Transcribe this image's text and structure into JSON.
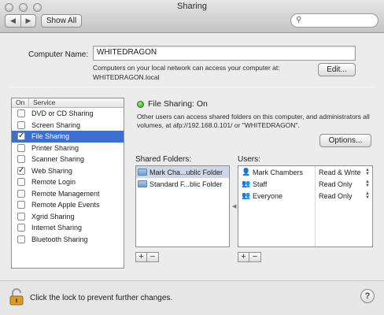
{
  "window": {
    "title": "Sharing"
  },
  "toolbar": {
    "back": "◀",
    "forward": "▶",
    "show_all": "Show All",
    "search_placeholder": ""
  },
  "computer_name": {
    "label": "Computer Name:",
    "value": "WHITEDRAGON",
    "note_line1": "Computers on your local network can access your computer at:",
    "note_line2": "WHITEDRAGON.local",
    "edit_button": "Edit..."
  },
  "services": {
    "header_on": "On",
    "header_service": "Service",
    "items": [
      {
        "label": "DVD or CD Sharing",
        "on": false,
        "selected": false
      },
      {
        "label": "Screen Sharing",
        "on": false,
        "selected": false
      },
      {
        "label": "File Sharing",
        "on": true,
        "selected": true
      },
      {
        "label": "Printer Sharing",
        "on": false,
        "selected": false
      },
      {
        "label": "Scanner Sharing",
        "on": false,
        "selected": false
      },
      {
        "label": "Web Sharing",
        "on": true,
        "selected": false
      },
      {
        "label": "Remote Login",
        "on": false,
        "selected": false
      },
      {
        "label": "Remote Management",
        "on": false,
        "selected": false
      },
      {
        "label": "Remote Apple Events",
        "on": false,
        "selected": false
      },
      {
        "label": "Xgrid Sharing",
        "on": false,
        "selected": false
      },
      {
        "label": "Internet Sharing",
        "on": false,
        "selected": false
      },
      {
        "label": "Bluetooth Sharing",
        "on": false,
        "selected": false
      }
    ]
  },
  "detail": {
    "status": "File Sharing: On",
    "status_color": "#2e9b1d",
    "description": "Other users can access shared folders on this computer, and administrators all volumes, at afp://192.168.0.101/ or \"WHITEDRAGON\".",
    "options_button": "Options...",
    "shared_folders_label": "Shared Folders:",
    "users_label": "Users:",
    "folders": [
      {
        "name": "Mark Cha...ublic Folder",
        "selected": true
      },
      {
        "name": "Standard F...blic Folder",
        "selected": false
      }
    ],
    "users": [
      {
        "name": "Mark Chambers",
        "icon": "user-icon",
        "permission": "Read & Write"
      },
      {
        "name": "Staff",
        "icon": "group-icon",
        "permission": "Read Only"
      },
      {
        "name": "Everyone",
        "icon": "group-icon",
        "permission": "Read Only"
      }
    ],
    "add": "+",
    "remove": "−"
  },
  "footer": {
    "lock_text": "Click the lock to prevent further changes.",
    "help": "?"
  },
  "colors": {
    "selection": "#3c6fd1",
    "lock": "#d79b2e"
  }
}
